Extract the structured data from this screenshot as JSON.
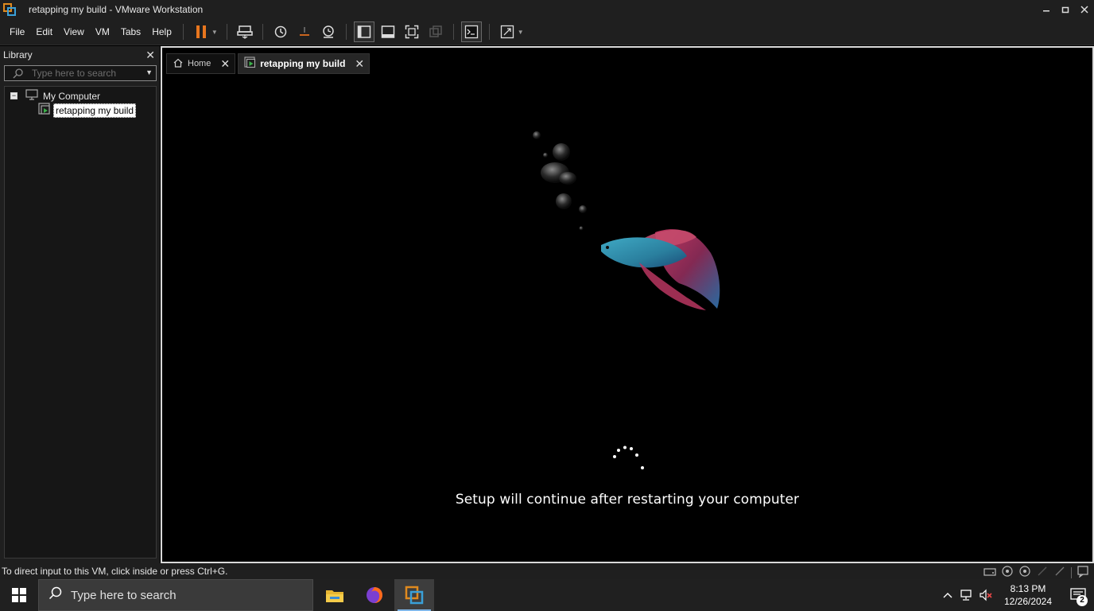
{
  "window": {
    "title": "retapping my build - VMware Workstation",
    "minimize_icon": "minimize-icon",
    "maximize_icon": "restore-icon",
    "close_icon": "close-icon"
  },
  "menu": {
    "items": [
      "File",
      "Edit",
      "View",
      "VM",
      "Tabs",
      "Help"
    ]
  },
  "toolbar": {
    "icons": [
      "pause-icon",
      "send-ctrl-alt-del-icon",
      "snapshot-icon",
      "revert-snapshot-icon",
      "snapshot-manager-icon",
      "show-library-icon",
      "thumbnail-bar-icon",
      "full-screen-icon",
      "unity-icon",
      "console-view-icon",
      "stretch-guest-icon"
    ]
  },
  "library": {
    "title": "Library",
    "search_placeholder": "Type here to search",
    "tree": {
      "root": "My Computer",
      "vms": [
        "retapping my build"
      ]
    }
  },
  "tabs": [
    {
      "label": "Home",
      "active": false
    },
    {
      "label": "retapping my build",
      "active": true
    }
  ],
  "vm_screen": {
    "message": "Setup will continue after restarting your computer"
  },
  "statusbar": {
    "text": "To direct input to this VM, click inside or press Ctrl+G."
  },
  "taskbar": {
    "search_placeholder": "Type here to search",
    "apps": [
      "file-explorer-icon",
      "firefox-icon",
      "vmware-workstation-icon"
    ],
    "time": "8:13 PM",
    "date": "12/26/2024",
    "notification_count": "2"
  },
  "colors": {
    "accent_orange": "#e08a1e",
    "accent_blue": "#3aa0d8",
    "chrome_bg": "#1f1f1f"
  }
}
